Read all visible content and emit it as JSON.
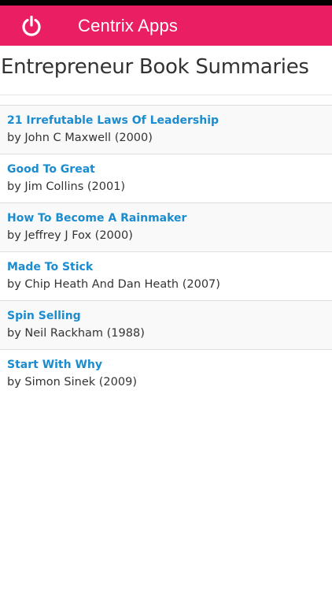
{
  "app_bar": {
    "title": "Centrix Apps",
    "icon": "power-icon",
    "color": "#ea1f63"
  },
  "page": {
    "title": "Entrepreneur Book Summaries"
  },
  "books": [
    {
      "title": "21 Irrefutable Laws Of Leadership",
      "author": "by John C Maxwell (2000)"
    },
    {
      "title": "Good To Great",
      "author": "by Jim Collins (2001)"
    },
    {
      "title": "How To Become A Rainmaker",
      "author": "by Jeffrey J Fox (2000)"
    },
    {
      "title": "Made To Stick",
      "author": "by Chip Heath And Dan Heath (2007)"
    },
    {
      "title": "Spin Selling",
      "author": "by Neil Rackham (1988)"
    },
    {
      "title": "Start With Why",
      "author": "by Simon Sinek (2009)"
    }
  ],
  "colors": {
    "link": "#1a8ccf",
    "text": "#333333",
    "row_alt": "#f9f9f9"
  }
}
